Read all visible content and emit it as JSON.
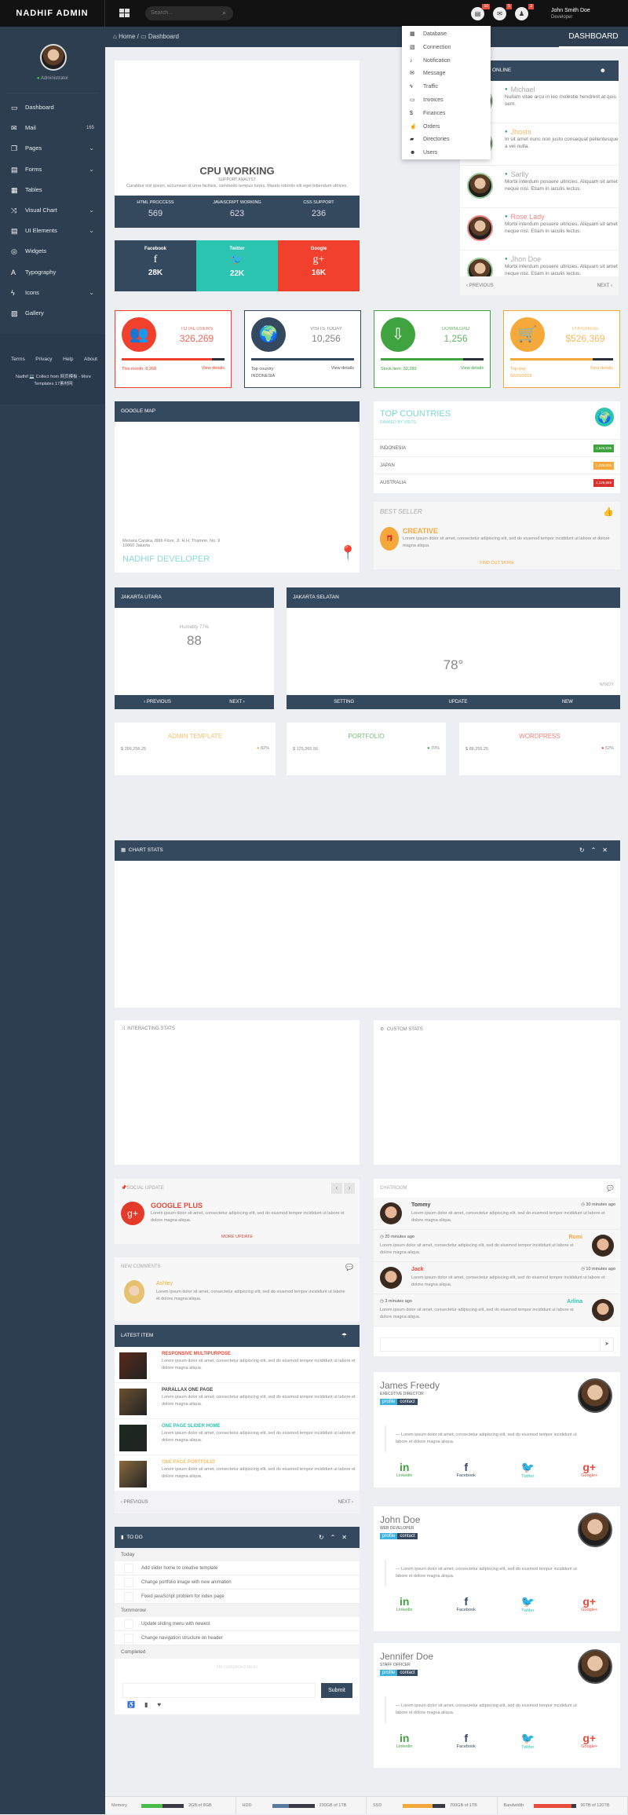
{
  "topbar": {
    "logo": "NADHIF ADMIN",
    "search_placeholder": "Search...",
    "notif_badges": [
      "10",
      "5",
      "3"
    ],
    "user_name": "John Smith Doe",
    "user_role": "Developer"
  },
  "sidebar": {
    "role": "Administrator",
    "items": [
      {
        "label": "Dashboard",
        "icon": "laptop-icon",
        "glyph": "▭"
      },
      {
        "label": "Mail",
        "icon": "mail-icon",
        "glyph": "✉",
        "count": "165"
      },
      {
        "label": "Pages",
        "icon": "pages-icon",
        "glyph": "❐",
        "chevron": true
      },
      {
        "label": "Forms",
        "icon": "form-icon",
        "glyph": "▤",
        "chevron": true
      },
      {
        "label": "Tables",
        "icon": "table-icon",
        "glyph": "▦"
      },
      {
        "label": "Visual Chart",
        "icon": "shuffle-icon",
        "glyph": "⤨",
        "chevron": true
      },
      {
        "label": "UI Elements",
        "icon": "ui-icon",
        "glyph": "▤",
        "chevron": true
      },
      {
        "label": "Widgets",
        "icon": "lifebuoy-icon",
        "glyph": "◎"
      },
      {
        "label": "Typography",
        "icon": "font-icon",
        "glyph": "A"
      },
      {
        "label": "Icons",
        "icon": "bolt-icon",
        "glyph": "ϟ",
        "chevron": true
      },
      {
        "label": "Gallery",
        "icon": "image-icon",
        "glyph": "▨"
      }
    ],
    "footer_links": [
      "Terms",
      "Privacy",
      "Help",
      "About"
    ],
    "credit": "Nadhif 💻 Collect from 网页模板 - More Templates 17素材网"
  },
  "breadcrumb": {
    "home": "Home",
    "current": "Dashboard",
    "page_title": "DASHBOARD"
  },
  "dropdown": [
    {
      "label": "Database",
      "glyph": "▦",
      "icon": "database-icon"
    },
    {
      "label": "Connection",
      "glyph": "▧",
      "icon": "connection-icon"
    },
    {
      "label": "Notification",
      "glyph": "♪",
      "icon": "bell-icon"
    },
    {
      "label": "Message",
      "glyph": "✉",
      "icon": "envelope-icon"
    },
    {
      "label": "Traffic",
      "glyph": "ϟ",
      "icon": "traffic-icon"
    },
    {
      "label": "Invoices",
      "glyph": "▭",
      "icon": "invoice-icon"
    },
    {
      "label": "Finances",
      "glyph": "$",
      "icon": "dollar-icon"
    },
    {
      "label": "Orders",
      "glyph": "☝",
      "icon": "thumb-icon"
    },
    {
      "label": "Directories",
      "glyph": "▰",
      "icon": "folder-icon"
    },
    {
      "label": "Users",
      "glyph": "☻",
      "icon": "users-icon"
    }
  ],
  "cpu": {
    "title": "CPU WORKING",
    "subtitle": "SUPPORT ANALYST",
    "text": "Curabitur nisl ipsum, accumsan id urna facilisis, commodo tempus turpis. Mauris lobortis elit eget bibendum ultrices.",
    "stats": [
      {
        "label": "HTML PROCCESS",
        "value": "569"
      },
      {
        "label": "JAVASCRIPT WORKING",
        "value": "623"
      },
      {
        "label": "CSS SUPPORT",
        "value": "236"
      }
    ]
  },
  "social": [
    {
      "name": "Facebook",
      "glyph": "f",
      "value": "28K",
      "color": "#34495e"
    },
    {
      "name": "Twitter",
      "glyph": "🐦",
      "value": "22K",
      "color": "#2bc4b0"
    },
    {
      "name": "Google",
      "glyph": "g+",
      "value": "16K",
      "color": "#f2402e"
    }
  ],
  "online": {
    "title": "ONLINE",
    "users": [
      {
        "name": "Michael",
        "text": "Nullam vitae arcu in leo molestie hendrerit at quis sem.",
        "color": "#aaa"
      },
      {
        "name": "Jhoshi",
        "text": "In sit amet nunc non justo consequat pellentesque a vel nulla.",
        "color": "#f5b86a"
      },
      {
        "name": "Sarlly",
        "text": "Morbi interdum posuere ultricies. Aliquam sit amet neque nisl. Etiam in iaculis lectus.",
        "color": "#aaa"
      },
      {
        "name": "Rose Lady",
        "text": "Morbi interdum posuere ultricies. Aliquam sit amet neque nisl. Etiam in iaculis lectus.",
        "color": "#e88"
      },
      {
        "name": "Jhon Doe",
        "text": "Morbi interdum posuere ultricies. Aliquam sit amet neque nisl. Etiam in iaculis lectus.",
        "color": "#aaa"
      }
    ],
    "prev": "‹ PREVIOUS",
    "next": "NEXT ›"
  },
  "stat_cards": [
    {
      "title": "TOTAL USERS",
      "value": "326,269",
      "left": "This month: 8,268",
      "right": "View details",
      "color": "#f2402e",
      "progress": 88,
      "glyph": "👥",
      "icon": "users-icon"
    },
    {
      "title": "VISITS TODAY",
      "value": "10,256",
      "left": "Top country:\nINDONESIA",
      "right": "View details",
      "color": "#34495e",
      "progress": 100,
      "glyph": "🌍",
      "icon": "globe-icon"
    },
    {
      "title": "DOWNLOAD",
      "value": "1,256",
      "left": "Stock item: 32,289",
      "right": "View details",
      "color": "#3fa340",
      "progress": 80,
      "glyph": "⇩",
      "icon": "download-icon"
    },
    {
      "title": "PURCHASE",
      "value": "$526,369",
      "left": "Top day:\n02/01/2015",
      "right": "View details",
      "color": "#f5a93b",
      "progress": 80,
      "glyph": "🛒",
      "icon": "cart-icon"
    }
  ],
  "map": {
    "title": "GOOGLE MAP",
    "address": "Menara Caraka, 88th Floor, Jl. H.H. Thamrin, No. 9\n10060 Jakarta",
    "company": "NADHIF DEVELOPER"
  },
  "countries": {
    "title": "TOP COUNTRIES",
    "subtitle": "RANKED BY VISITS",
    "rows": [
      {
        "name": "INDONESIA",
        "value": "1,526,536",
        "color": "#3fa340"
      },
      {
        "name": "JAPAN",
        "value": "1,326,005",
        "color": "#f5a93b"
      },
      {
        "name": "AUSTRALIA",
        "value": "1,126,659",
        "color": "#d9312b"
      }
    ]
  },
  "best_seller": {
    "title": "BEST SELLER",
    "name": "CREATIVE",
    "text": "Lorem ipsum dolor sit amet, consectetur adipiscing elit, sed do eiusmod tempor incididunt ut labore et dolore magna aliqua.",
    "link": "FIND OUT MORE"
  },
  "weather1": {
    "title": "JAKARTA UTARA",
    "humidity": "Humidity 77%",
    "value": "88",
    "prev": "‹ PREVIOUS",
    "next": "NEXT ›"
  },
  "weather2": {
    "title": "JAKARTA SELATAN",
    "temp": "78°",
    "condition": "WINDY",
    "buttons": [
      "SETTING",
      "UPDATE",
      "NEW"
    ]
  },
  "revenue": [
    {
      "title": "ADMIN TEMPLATE",
      "amount": "$ 356,256.25",
      "pct": "82%",
      "color": "#f5a93b"
    },
    {
      "title": "PORTFOLIO",
      "amount": "$ 125,365.56",
      "pct": "70%",
      "color": "#3fa340"
    },
    {
      "title": "WORDPRESS",
      "amount": "$ 88,256.25",
      "pct": "52%",
      "color": "#e74c3c"
    }
  ],
  "chart_stats": {
    "title": "CHART STATS"
  },
  "interacting": {
    "title": "INTERACTING STATS"
  },
  "custom": {
    "title": "CUSTOM STATS"
  },
  "social_update": {
    "title": "SOCIAL UPDATE",
    "name": "GOOGLE PLUS",
    "text": "Lorem ipsum dolor sit amet, consectetur adipiscing elit, sed do eiusmod tempor incididunt ut labore et dolore magna aliqua.",
    "link": "MORE UPDATE"
  },
  "comments": {
    "title": "NEW COMMENTS",
    "name": "Ashley",
    "text": "Lorem ipsum dolor sit amet, consectetur adipiscing elit, sed do eiusmod tempor incididunt ut labore et dolore magna aliqua."
  },
  "latest": {
    "title": "LATEST ITEM",
    "items": [
      {
        "title": "RESPONSIVE MULTIPURPOSE",
        "color": "#e74c3c"
      },
      {
        "title": "PARALLAX ONE PAGE",
        "color": "#444"
      },
      {
        "title": "ONE PAGE SLIDER HOME",
        "color": "#2bc4b0"
      },
      {
        "title": "ONE PAGE PORTFOLIO",
        "color": "#f5c06b"
      }
    ],
    "text": "Lorem ipsum dolor sit amet, consectetur adipiscing elit, sed do eiusmod tempor incididunt ut labore et dolore magna aliqua.",
    "prev": "‹ PREVIOUS",
    "next": "NEXT ›"
  },
  "todo": {
    "title": "TO DO",
    "groups": [
      {
        "label": "Today",
        "items": [
          "Add slider home to creative template",
          "Change portfolio image with new animation",
          "Fixed javaScript problem for index page"
        ]
      },
      {
        "label": "Tommorow",
        "items": [
          "Update sliding menu with newest",
          "Change navigation structure on header"
        ]
      },
      {
        "label": "Completed",
        "items": []
      }
    ],
    "empty": "No completed tasks",
    "submit": "Submit"
  },
  "chatroom": {
    "title": "CHATROOM",
    "messages": [
      {
        "name": "Tommy",
        "time": "30 minutes ago",
        "side": "left",
        "color": "#444"
      },
      {
        "name": "Romi",
        "time": "20 minutes ago",
        "side": "right",
        "color": "#f5a93b"
      },
      {
        "name": "Jack",
        "time": "10 minutes ago",
        "side": "left",
        "color": "#e74c3c"
      },
      {
        "name": "Arlina",
        "time": "3 minutes ago",
        "side": "right",
        "color": "#2bc4b0"
      }
    ],
    "text": "Lorem ipsum dolor sit amet, consectetur adipiscing elit, sed do eiusmod tempor incididunt ut labore et dolore magna aliqua."
  },
  "profiles": [
    {
      "name": "James Freedy",
      "role": "EXECUTIVE DIRECTOR"
    },
    {
      "name": "John Doe",
      "role": "WEB DEVELOPER"
    },
    {
      "name": "Jennifer Doe",
      "role": "STAFF OFFICER"
    }
  ],
  "profile_common": {
    "tag1": "profile",
    "tag2": "contact",
    "quote": "— Lorem ipsum dolor sit amet, consectetur adipiscing elit, sed do eiusmod tempor incididunt ut labore et dolore magna aliqua.",
    "social": [
      {
        "label": "Linkedin",
        "glyph": "in",
        "color": "#3fa340"
      },
      {
        "label": "Facebook",
        "glyph": "f",
        "color": "#34495e"
      },
      {
        "label": "Twitter",
        "glyph": "🐦",
        "color": "#2bc4b0"
      },
      {
        "label": "Google+",
        "glyph": "g+",
        "color": "#e74c3c"
      }
    ]
  },
  "footer_stats": [
    {
      "label": "Memory",
      "value": "2GB of 8GB",
      "pct": 50,
      "color": "#4cbb4c"
    },
    {
      "label": "HDD",
      "value": "230GB of 1TB",
      "pct": 40,
      "color": "#5a7aa0"
    },
    {
      "label": "SSD",
      "value": "700GB of 1TB",
      "pct": 70,
      "color": "#f5a93b"
    },
    {
      "label": "Bandwidth",
      "value": "90TB of 120TB",
      "pct": 90,
      "color": "#e74c3c"
    }
  ]
}
